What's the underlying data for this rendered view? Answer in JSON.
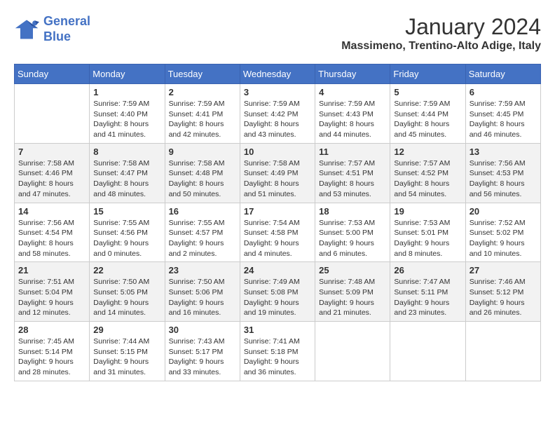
{
  "header": {
    "logo_line1": "General",
    "logo_line2": "Blue",
    "month": "January 2024",
    "location": "Massimeno, Trentino-Alto Adige, Italy"
  },
  "weekdays": [
    "Sunday",
    "Monday",
    "Tuesday",
    "Wednesday",
    "Thursday",
    "Friday",
    "Saturday"
  ],
  "weeks": [
    [
      {
        "day": "",
        "sunrise": "",
        "sunset": "",
        "daylight": ""
      },
      {
        "day": "1",
        "sunrise": "Sunrise: 7:59 AM",
        "sunset": "Sunset: 4:40 PM",
        "daylight": "Daylight: 8 hours and 41 minutes."
      },
      {
        "day": "2",
        "sunrise": "Sunrise: 7:59 AM",
        "sunset": "Sunset: 4:41 PM",
        "daylight": "Daylight: 8 hours and 42 minutes."
      },
      {
        "day": "3",
        "sunrise": "Sunrise: 7:59 AM",
        "sunset": "Sunset: 4:42 PM",
        "daylight": "Daylight: 8 hours and 43 minutes."
      },
      {
        "day": "4",
        "sunrise": "Sunrise: 7:59 AM",
        "sunset": "Sunset: 4:43 PM",
        "daylight": "Daylight: 8 hours and 44 minutes."
      },
      {
        "day": "5",
        "sunrise": "Sunrise: 7:59 AM",
        "sunset": "Sunset: 4:44 PM",
        "daylight": "Daylight: 8 hours and 45 minutes."
      },
      {
        "day": "6",
        "sunrise": "Sunrise: 7:59 AM",
        "sunset": "Sunset: 4:45 PM",
        "daylight": "Daylight: 8 hours and 46 minutes."
      }
    ],
    [
      {
        "day": "7",
        "sunrise": "Sunrise: 7:58 AM",
        "sunset": "Sunset: 4:46 PM",
        "daylight": "Daylight: 8 hours and 47 minutes."
      },
      {
        "day": "8",
        "sunrise": "Sunrise: 7:58 AM",
        "sunset": "Sunset: 4:47 PM",
        "daylight": "Daylight: 8 hours and 48 minutes."
      },
      {
        "day": "9",
        "sunrise": "Sunrise: 7:58 AM",
        "sunset": "Sunset: 4:48 PM",
        "daylight": "Daylight: 8 hours and 50 minutes."
      },
      {
        "day": "10",
        "sunrise": "Sunrise: 7:58 AM",
        "sunset": "Sunset: 4:49 PM",
        "daylight": "Daylight: 8 hours and 51 minutes."
      },
      {
        "day": "11",
        "sunrise": "Sunrise: 7:57 AM",
        "sunset": "Sunset: 4:51 PM",
        "daylight": "Daylight: 8 hours and 53 minutes."
      },
      {
        "day": "12",
        "sunrise": "Sunrise: 7:57 AM",
        "sunset": "Sunset: 4:52 PM",
        "daylight": "Daylight: 8 hours and 54 minutes."
      },
      {
        "day": "13",
        "sunrise": "Sunrise: 7:56 AM",
        "sunset": "Sunset: 4:53 PM",
        "daylight": "Daylight: 8 hours and 56 minutes."
      }
    ],
    [
      {
        "day": "14",
        "sunrise": "Sunrise: 7:56 AM",
        "sunset": "Sunset: 4:54 PM",
        "daylight": "Daylight: 8 hours and 58 minutes."
      },
      {
        "day": "15",
        "sunrise": "Sunrise: 7:55 AM",
        "sunset": "Sunset: 4:56 PM",
        "daylight": "Daylight: 9 hours and 0 minutes."
      },
      {
        "day": "16",
        "sunrise": "Sunrise: 7:55 AM",
        "sunset": "Sunset: 4:57 PM",
        "daylight": "Daylight: 9 hours and 2 minutes."
      },
      {
        "day": "17",
        "sunrise": "Sunrise: 7:54 AM",
        "sunset": "Sunset: 4:58 PM",
        "daylight": "Daylight: 9 hours and 4 minutes."
      },
      {
        "day": "18",
        "sunrise": "Sunrise: 7:53 AM",
        "sunset": "Sunset: 5:00 PM",
        "daylight": "Daylight: 9 hours and 6 minutes."
      },
      {
        "day": "19",
        "sunrise": "Sunrise: 7:53 AM",
        "sunset": "Sunset: 5:01 PM",
        "daylight": "Daylight: 9 hours and 8 minutes."
      },
      {
        "day": "20",
        "sunrise": "Sunrise: 7:52 AM",
        "sunset": "Sunset: 5:02 PM",
        "daylight": "Daylight: 9 hours and 10 minutes."
      }
    ],
    [
      {
        "day": "21",
        "sunrise": "Sunrise: 7:51 AM",
        "sunset": "Sunset: 5:04 PM",
        "daylight": "Daylight: 9 hours and 12 minutes."
      },
      {
        "day": "22",
        "sunrise": "Sunrise: 7:50 AM",
        "sunset": "Sunset: 5:05 PM",
        "daylight": "Daylight: 9 hours and 14 minutes."
      },
      {
        "day": "23",
        "sunrise": "Sunrise: 7:50 AM",
        "sunset": "Sunset: 5:06 PM",
        "daylight": "Daylight: 9 hours and 16 minutes."
      },
      {
        "day": "24",
        "sunrise": "Sunrise: 7:49 AM",
        "sunset": "Sunset: 5:08 PM",
        "daylight": "Daylight: 9 hours and 19 minutes."
      },
      {
        "day": "25",
        "sunrise": "Sunrise: 7:48 AM",
        "sunset": "Sunset: 5:09 PM",
        "daylight": "Daylight: 9 hours and 21 minutes."
      },
      {
        "day": "26",
        "sunrise": "Sunrise: 7:47 AM",
        "sunset": "Sunset: 5:11 PM",
        "daylight": "Daylight: 9 hours and 23 minutes."
      },
      {
        "day": "27",
        "sunrise": "Sunrise: 7:46 AM",
        "sunset": "Sunset: 5:12 PM",
        "daylight": "Daylight: 9 hours and 26 minutes."
      }
    ],
    [
      {
        "day": "28",
        "sunrise": "Sunrise: 7:45 AM",
        "sunset": "Sunset: 5:14 PM",
        "daylight": "Daylight: 9 hours and 28 minutes."
      },
      {
        "day": "29",
        "sunrise": "Sunrise: 7:44 AM",
        "sunset": "Sunset: 5:15 PM",
        "daylight": "Daylight: 9 hours and 31 minutes."
      },
      {
        "day": "30",
        "sunrise": "Sunrise: 7:43 AM",
        "sunset": "Sunset: 5:17 PM",
        "daylight": "Daylight: 9 hours and 33 minutes."
      },
      {
        "day": "31",
        "sunrise": "Sunrise: 7:41 AM",
        "sunset": "Sunset: 5:18 PM",
        "daylight": "Daylight: 9 hours and 36 minutes."
      },
      {
        "day": "",
        "sunrise": "",
        "sunset": "",
        "daylight": ""
      },
      {
        "day": "",
        "sunrise": "",
        "sunset": "",
        "daylight": ""
      },
      {
        "day": "",
        "sunrise": "",
        "sunset": "",
        "daylight": ""
      }
    ]
  ]
}
